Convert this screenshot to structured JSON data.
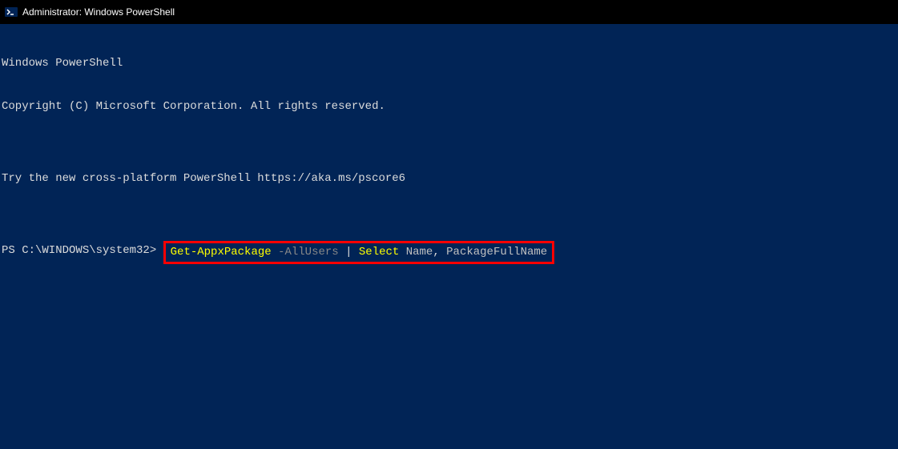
{
  "titlebar": {
    "title": "Administrator: Windows PowerShell"
  },
  "terminal": {
    "line1": "Windows PowerShell",
    "line2": "Copyright (C) Microsoft Corporation. All rights reserved.",
    "line3": "",
    "line4": "Try the new cross-platform PowerShell https://aka.ms/pscore6",
    "line5": "",
    "prompt": "PS C:\\WINDOWS\\system32> ",
    "command": {
      "cmdlet1": "Get-AppxPackage",
      "param1": " -AllUsers",
      "pipe": " | ",
      "cmdlet2": "Select",
      "arg1": " Name",
      "comma": ",",
      "arg2": " PackageFullName"
    }
  }
}
